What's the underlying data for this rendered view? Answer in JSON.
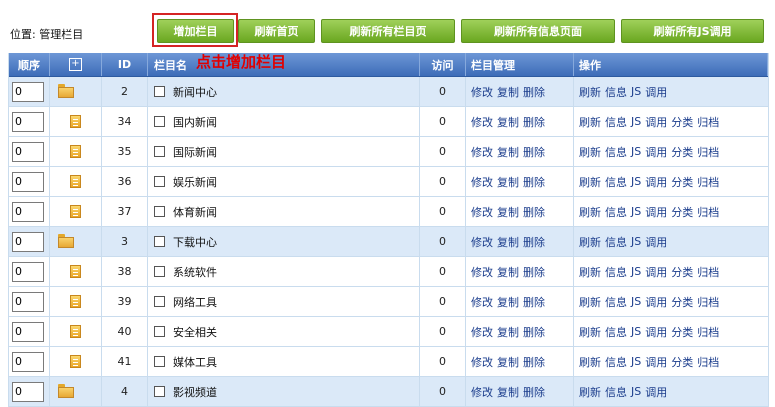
{
  "breadcrumb": "位置: 管理栏目",
  "toolbar": {
    "add_column": "增加栏目",
    "refresh_home": "刷新首页",
    "refresh_all_columns": "刷新所有栏目页",
    "refresh_all_info": "刷新所有信息页面",
    "refresh_all_js": "刷新所有JS调用"
  },
  "annotation": "点击增加栏目",
  "table": {
    "headers": {
      "order": "顺序",
      "expand": "+",
      "id": "ID",
      "name": "栏目名",
      "visits": "访问",
      "manage": "栏目管理",
      "ops": "操作"
    },
    "actions": {
      "edit": "修改",
      "copy": "复制",
      "delete": "删除",
      "refresh": "刷新",
      "info": "信息",
      "js": "JS",
      "call": "调用",
      "classify": "分类",
      "archive": "归档"
    },
    "rows": [
      {
        "order": "0",
        "id": "2",
        "name": "新闻中心",
        "visits": "0",
        "type": "category"
      },
      {
        "order": "0",
        "id": "34",
        "name": "国内新闻",
        "visits": "0",
        "type": "sub"
      },
      {
        "order": "0",
        "id": "35",
        "name": "国际新闻",
        "visits": "0",
        "type": "sub"
      },
      {
        "order": "0",
        "id": "36",
        "name": "娱乐新闻",
        "visits": "0",
        "type": "sub"
      },
      {
        "order": "0",
        "id": "37",
        "name": "体育新闻",
        "visits": "0",
        "type": "sub"
      },
      {
        "order": "0",
        "id": "3",
        "name": "下载中心",
        "visits": "0",
        "type": "category"
      },
      {
        "order": "0",
        "id": "38",
        "name": "系统软件",
        "visits": "0",
        "type": "sub"
      },
      {
        "order": "0",
        "id": "39",
        "name": "网络工具",
        "visits": "0",
        "type": "sub"
      },
      {
        "order": "0",
        "id": "40",
        "name": "安全相关",
        "visits": "0",
        "type": "sub"
      },
      {
        "order": "0",
        "id": "41",
        "name": "媒体工具",
        "visits": "0",
        "type": "sub"
      },
      {
        "order": "0",
        "id": "4",
        "name": "影视频道",
        "visits": "0",
        "type": "category"
      }
    ]
  }
}
